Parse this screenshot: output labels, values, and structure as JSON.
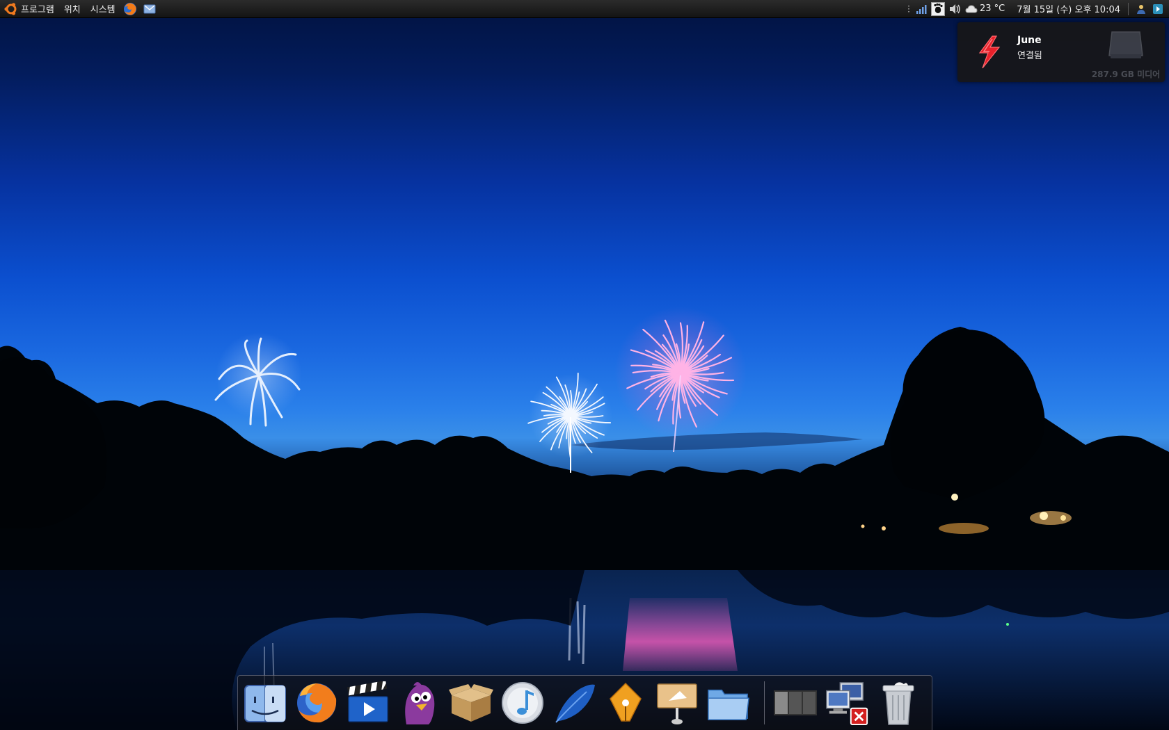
{
  "top_panel": {
    "menus": [
      "프로그램",
      "위치",
      "시스템"
    ],
    "launchers": [
      "firefox-icon",
      "email-icon"
    ],
    "tray": {
      "icons": [
        "network-signal-icon",
        "gnome-foot-icon",
        "volume-icon"
      ],
      "weather_icon": "weather-cloud-icon",
      "temperature": "23 °C",
      "clock": "7월 15일 (수) 오후 10:04",
      "right_icons": [
        "user-switch-icon",
        "shutdown-icon"
      ]
    }
  },
  "notification": {
    "icon": "lightning-bolt-icon",
    "title": "June",
    "body": "연결됨",
    "drive_icon": "hard-drive-icon",
    "drive_label": "287.9 GB 미디어"
  },
  "dock": {
    "items": [
      "finder-icon",
      "firefox-icon",
      "video-clapperboard-icon",
      "pidgin-icon",
      "package-box-icon",
      "music-icon",
      "feather-icon",
      "pen-nib-icon",
      "presentation-icon",
      "folder-icon"
    ],
    "system_items": [
      "workspace-switcher-icon",
      "network-disconnected-icon",
      "trash-icon"
    ]
  },
  "colors": {
    "panel": "#1e1e1e",
    "sky_top": "#01123f",
    "sky_horizon": "#3a8fe8",
    "firework_pink": "#ff6ec7",
    "notification_accent": "#e8202a"
  }
}
